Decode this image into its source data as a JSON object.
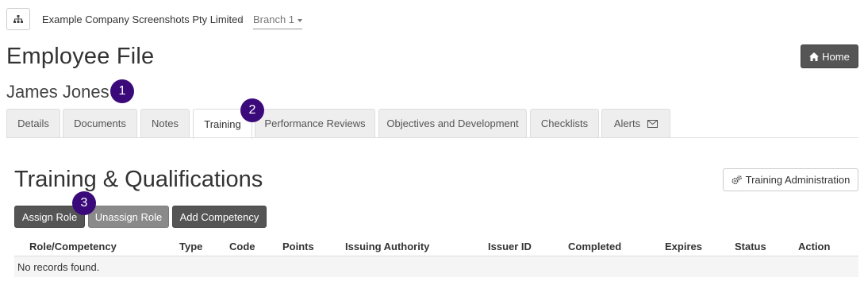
{
  "breadcrumb": {
    "company": "Example Company Screenshots Pty Limited",
    "separator": "/",
    "branch": "Branch 1"
  },
  "header": {
    "title": "Employee File",
    "home_label": "Home"
  },
  "employee": {
    "name": "James Jones"
  },
  "badges": [
    "1",
    "2",
    "3"
  ],
  "tabs": [
    {
      "label": "Details"
    },
    {
      "label": "Documents"
    },
    {
      "label": "Notes"
    },
    {
      "label": "Training",
      "active": true
    },
    {
      "label": "Performance Reviews"
    },
    {
      "label": "Objectives and Development"
    },
    {
      "label": "Checklists"
    },
    {
      "label": "Alerts"
    }
  ],
  "section": {
    "title": "Training & Qualifications",
    "admin_label": "Training Administration"
  },
  "actions": {
    "assign": "Assign Role",
    "unassign": "Unassign Role",
    "add_competency": "Add Competency"
  },
  "table": {
    "columns": [
      "Role/Competency",
      "Type",
      "Code",
      "Points",
      "Issuing Authority",
      "Issuer ID",
      "Completed",
      "Expires",
      "Status",
      "Action"
    ],
    "empty_message": "No records found."
  },
  "icons": {
    "org": "sitemap-icon",
    "home": "home-icon",
    "alerts": "envelope-icon",
    "admin": "cogs-icon"
  },
  "colors": {
    "badge": "#3b0a7a",
    "dark_button": "#555555",
    "disabled_button": "#8a8a8a"
  }
}
